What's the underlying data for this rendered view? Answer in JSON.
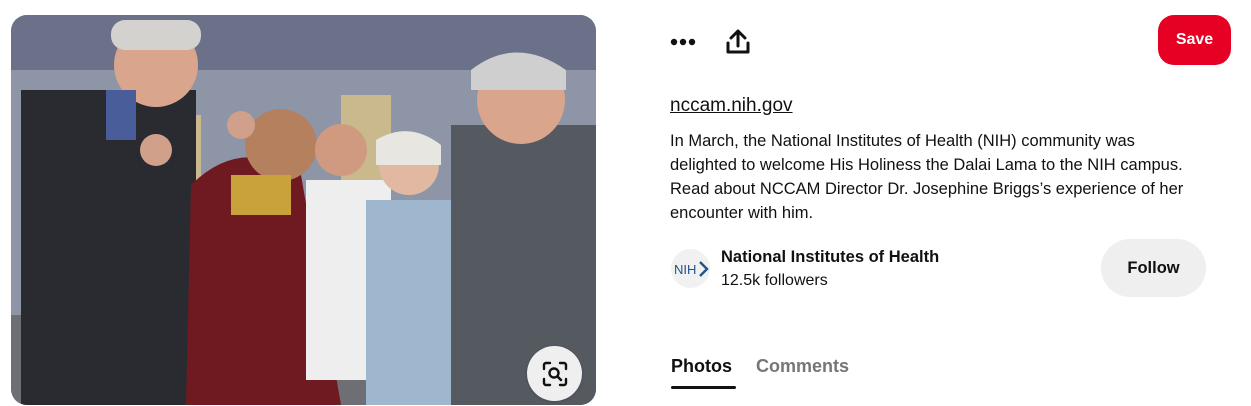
{
  "pin": {
    "image_alt": "NIH leaders greeting the Dalai Lama",
    "visual_search_icon": "magnifier-in-frame-icon"
  },
  "toolbar": {
    "more_icon": "ellipsis-icon",
    "share_icon": "share-upload-icon",
    "save_label": "Save",
    "save_color": "#e60023"
  },
  "details": {
    "source_link": "nccam.nih.gov",
    "description": "In March, the National Institutes of Health (NIH) community was delighted to welcome His Holiness the Dalai Lama to the NIH campus. Read about NCCAM Director Dr. Josephine Briggs’s experience of her encounter with him."
  },
  "creator": {
    "avatar_text": "NIH",
    "name": "National Institutes of Health",
    "followers": "12.5k followers",
    "follow_label": "Follow"
  },
  "tabs": [
    {
      "label": "Photos",
      "active": true
    },
    {
      "label": "Comments",
      "active": false
    }
  ]
}
